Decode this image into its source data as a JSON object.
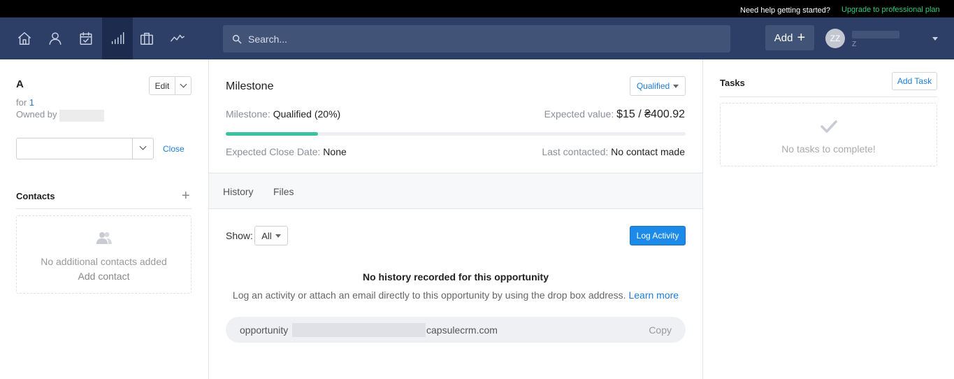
{
  "topbar": {
    "help_text": "Need help getting started?",
    "upgrade_text": "Upgrade to professional plan"
  },
  "nav": {
    "icons": [
      "home-icon",
      "person-icon",
      "calendar-icon",
      "pipeline-icon",
      "briefcase-icon",
      "trend-icon"
    ],
    "active": "pipeline-icon",
    "search_placeholder": "Search...",
    "add_label": "Add",
    "avatar_initials": "ZZ",
    "user_sub": "Z"
  },
  "left": {
    "opportunity_name": "A",
    "for_label": "for",
    "for_link": "1",
    "owned_by_label": "Owned by",
    "edit_label": "Edit",
    "close_label": "Close",
    "contacts_heading": "Contacts",
    "contacts_empty": "No additional contacts added",
    "add_contact": "Add contact"
  },
  "main": {
    "milestone_heading": "Milestone",
    "milestone_button": "Qualified",
    "milestone_label": "Milestone:",
    "milestone_value": "Qualified (20%)",
    "progress_percent": 20,
    "expected_value_label": "Expected value:",
    "expected_value": "$15 / ₴400.92",
    "close_date_label": "Expected Close Date:",
    "close_date_value": "None",
    "last_contacted_label": "Last contacted:",
    "last_contacted_value": "No contact made",
    "tabs": [
      "History",
      "Files"
    ],
    "show_label": "Show:",
    "show_value": "All",
    "log_activity": "Log Activity",
    "no_history": "No history recorded for this opportunity",
    "history_desc": "Log an activity or attach an email directly to this opportunity by using the drop box address.",
    "learn_more": "Learn more",
    "dropbox_prefix": "opportunity",
    "dropbox_suffix": "capsulecrm.com",
    "copy_label": "Copy"
  },
  "right": {
    "tasks_heading": "Tasks",
    "add_task": "Add Task",
    "no_tasks": "No tasks to complete!"
  },
  "colors": {
    "nav_bg": "#2d3f66",
    "accent": "#1c8ae8",
    "progress": "#3ac2a0",
    "upgrade": "#2fce7a"
  }
}
